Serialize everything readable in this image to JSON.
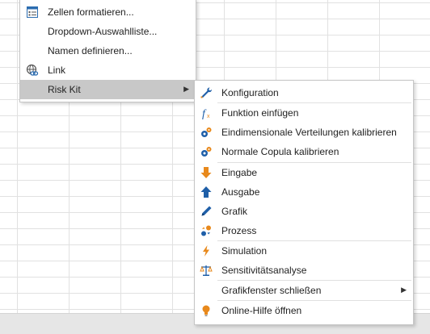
{
  "context_menu": {
    "items": [
      {
        "label": "Zellen formatieren...",
        "icon": "format-cells-icon"
      },
      {
        "label": "Dropdown-Auswahlliste...",
        "icon": ""
      },
      {
        "label": "Namen definieren...",
        "icon": ""
      },
      {
        "label": "Link",
        "icon": "link-icon"
      },
      {
        "label": "Risk Kit",
        "icon": "",
        "submenu_arrow": "▶"
      }
    ]
  },
  "risk_kit_menu": {
    "items": [
      {
        "label": "Konfiguration",
        "icon": "wrench-icon"
      },
      {
        "label": "Funktion einfügen",
        "icon": "function-icon"
      },
      {
        "label": "Eindimensionale Verteilungen kalibrieren",
        "icon": "gears-icon"
      },
      {
        "label": "Normale Copula kalibrieren",
        "icon": "gears-icon"
      },
      {
        "label": "Eingabe",
        "icon": "down-arrow-icon"
      },
      {
        "label": "Ausgabe",
        "icon": "up-arrow-icon"
      },
      {
        "label": "Grafik",
        "icon": "pen-icon"
      },
      {
        "label": "Prozess",
        "icon": "process-icon"
      },
      {
        "label": "Simulation",
        "icon": "lightning-icon"
      },
      {
        "label": "Sensitivitätsanalyse",
        "icon": "scale-icon"
      },
      {
        "label": "Grafikfenster schließen",
        "icon": "",
        "submenu_arrow": "▶"
      },
      {
        "label": "Online-Hilfe öffnen",
        "icon": "lightbulb-icon"
      }
    ]
  },
  "colors": {
    "orange": "#e8891c",
    "blue": "#1f5fa8",
    "highlight": "#c8c8c8"
  }
}
